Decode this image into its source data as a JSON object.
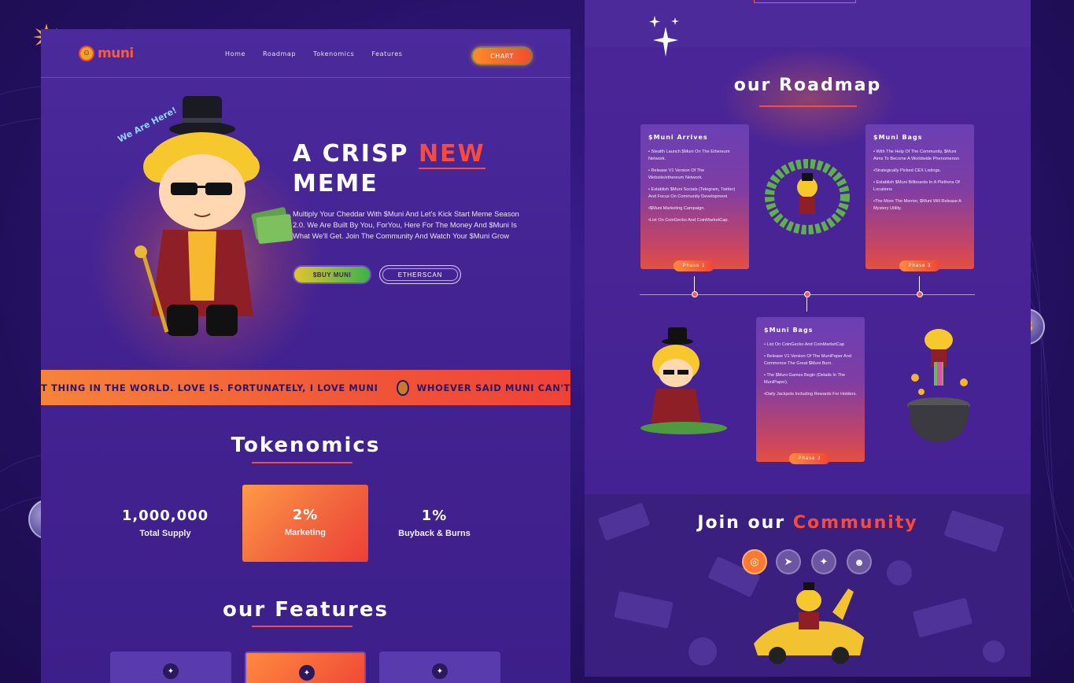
{
  "nav": {
    "brand": "muni",
    "links": [
      "Home",
      "Roadmap",
      "Tokenomics",
      "Features"
    ],
    "chart_button": "CHART"
  },
  "hero": {
    "badge": "We Are Here!",
    "title_part1": "A CRISP",
    "title_accent": "NEW",
    "title_part2": "MEME",
    "description": "Multiply Your Cheddar With $Muni And Let's Kick Start Meme Season 2.0. We Are Built By You, ForYou, Here For The Money And $Muni Is What We'll Get. Join The Community And Watch Your $Muni Grow",
    "buy_button": "$BUY MUNI",
    "etherscan_button": "ETHERSCAN"
  },
  "ticker": {
    "text1": "T THING IN THE WORLD. LOVE IS. FORTUNATELY, I LOVE MUNI",
    "text2": "WHOEVER SAID MUNI CAN'T"
  },
  "tokenomics": {
    "title": "Tokenomics",
    "items": [
      {
        "value": "1,000,000",
        "label": "Total Supply"
      },
      {
        "value": "2%",
        "label": "Marketing"
      },
      {
        "value": "1%",
        "label": "Buyback & Burns"
      }
    ]
  },
  "features": {
    "title": "our Features"
  },
  "roadmap": {
    "title": "our Roadmap",
    "phases": [
      {
        "heading": "$Muni Arrives",
        "items": [
          "• Stealth Launch $Muni On The Ethereum Network.",
          "• Release V1 Version Of The Website/ethereum Network.",
          "• Establish $Muni Socials (Telegram, Twitter) And Focus On Community Development",
          "•$Muni Marketing Campaign.",
          "•List On CoinGecko And CoinMarketCap."
        ],
        "pill": "Phase 1"
      },
      {
        "heading": "$Muni Bags",
        "items": [
          "• With The Help Of The Community, $Muni Aims To Become A Worldwide Phenomenon",
          "•Strategically Picked CEX Listings.",
          "• Establish $Muni Billboards In A Plethora Of Locations",
          "•The More The Merrier, $Muni Will Release A Mystery Utility."
        ],
        "pill": "Phase 3"
      },
      {
        "heading": "$Muni Bags",
        "items": [
          "• List On CoinGecko And CoinMarketCap",
          "• Release V1 Version Of The MuniPaper And Commence The Great $Muni Burn.",
          "• The $Muni Games Begin (Details In The MuniPaper).",
          "•Daily Jackpots Including Rewards For Holders."
        ],
        "pill": "Phase 2"
      }
    ]
  },
  "community": {
    "title_part1": "Join our",
    "title_accent": "Community",
    "socials": [
      "instagram-icon",
      "telegram-icon",
      "twitter-icon",
      "discord-icon"
    ]
  },
  "colors": {
    "accent": "#ff4a3a",
    "orange": "#ff8a3e",
    "panel": "#432392"
  }
}
